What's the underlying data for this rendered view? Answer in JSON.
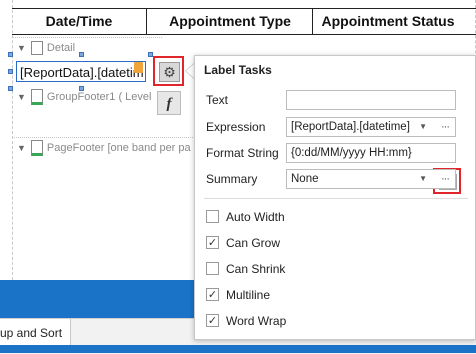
{
  "table_headers": [
    "Date/Time",
    "Appointment Type",
    "Appointment Status"
  ],
  "bands": {
    "detail": "Detail",
    "group_footer": "GroupFooter1 ( Level",
    "page_footer": "PageFooter [one band per pa"
  },
  "selected_label": "[ReportData].[datetim",
  "bottom_tab": "up and Sort",
  "popup": {
    "title": "Label Tasks",
    "text_label": "Text",
    "text_value": "",
    "expression_label": "Expression",
    "expression_value": "[ReportData].[datetime]",
    "format_label": "Format String",
    "format_value": "{0:dd/MM/yyyy HH:mm}",
    "summary_label": "Summary",
    "summary_value": "None",
    "checkboxes": [
      {
        "label": "Auto Width",
        "checked": false
      },
      {
        "label": "Can Grow",
        "checked": true
      },
      {
        "label": "Can Shrink",
        "checked": false
      },
      {
        "label": "Multiline",
        "checked": true
      },
      {
        "label": "Word Wrap",
        "checked": true
      }
    ]
  },
  "colors": {
    "accent_blue": "#1a73c7",
    "highlight_red": "#e0262b"
  }
}
